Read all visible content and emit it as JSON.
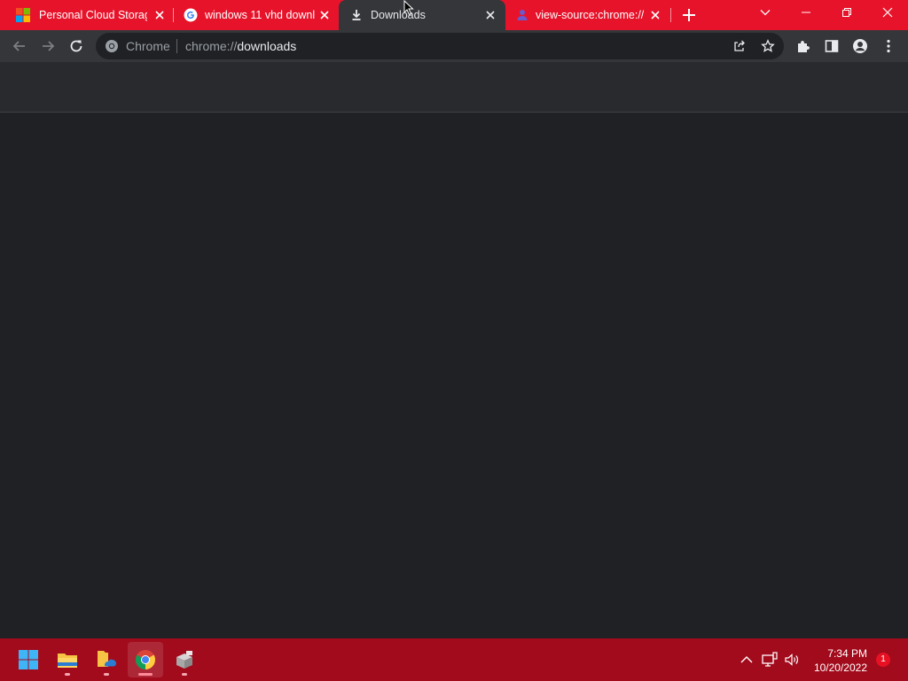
{
  "tabs": [
    {
      "title": "Personal Cloud Storage",
      "favicon": "microsoft-logo-icon"
    },
    {
      "title": "windows 11 vhd downl",
      "favicon": "google-g-icon"
    },
    {
      "title": "Downloads",
      "favicon": "download-icon",
      "active": true
    },
    {
      "title": "view-source:chrome://d",
      "favicon": "profile-favicon-icon"
    }
  ],
  "omnibox": {
    "site_label": "Chrome",
    "url_scheme": "chrome://",
    "url_host": "downloads"
  },
  "taskbar": {
    "apps": [
      "windows-start",
      "file-explorer",
      "onedrive-folder",
      "google-chrome",
      "recycle-app"
    ],
    "time": "7:34 PM",
    "date": "10/20/2022",
    "notification_count": "1"
  },
  "colors": {
    "tab_strip": "#e7132a",
    "toolbar": "#35363a",
    "page_background": "#202124",
    "taskbar": "#a20b1c"
  }
}
